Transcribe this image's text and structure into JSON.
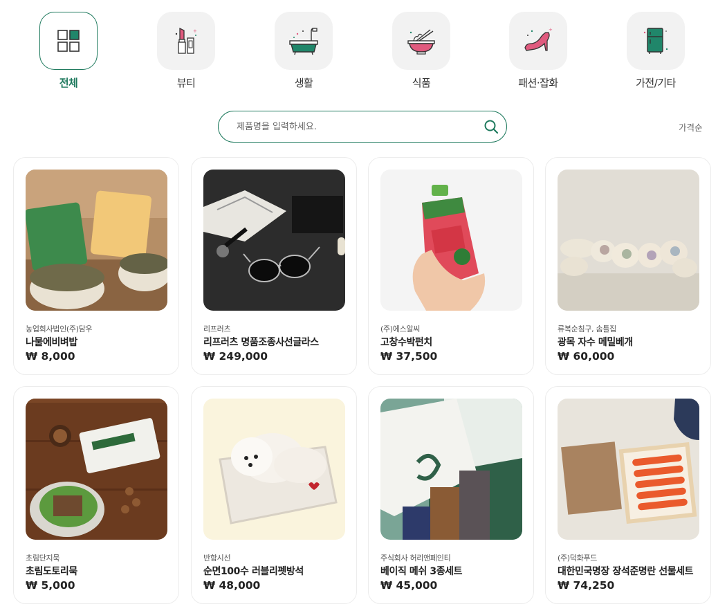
{
  "categories": [
    {
      "label": "전체",
      "icon": "grid-icon",
      "active": true
    },
    {
      "label": "뷰티",
      "icon": "lipstick-icon",
      "active": false
    },
    {
      "label": "생활",
      "icon": "bathtub-icon",
      "active": false
    },
    {
      "label": "식품",
      "icon": "noodle-bowl-icon",
      "active": false
    },
    {
      "label": "패션·잡화",
      "icon": "high-heel-icon",
      "active": false
    },
    {
      "label": "가전/기타",
      "icon": "refrigerator-icon",
      "active": false
    }
  ],
  "search": {
    "placeholder": "제품명을 입력하세요.",
    "value": ""
  },
  "sort": {
    "label": "가격순"
  },
  "products": [
    {
      "seller": "농업회사법인(주)담우",
      "name": "나물에비벼밥",
      "price": "₩ 8,000"
    },
    {
      "seller": "리프러츠",
      "name": "리프러츠 명품조종사선글라스",
      "price": "₩ 249,000"
    },
    {
      "seller": "(주)에스알씨",
      "name": "고창수박펀치",
      "price": "₩ 37,500"
    },
    {
      "seller": "류복순침구, 솜틀집",
      "name": "광목 자수 메밀베개",
      "price": "₩ 60,000"
    },
    {
      "seller": "초림단지묵",
      "name": "초림도토리묵",
      "price": "₩ 5,000"
    },
    {
      "seller": "반함시선",
      "name": "순면100수 러블리펫방석",
      "price": "₩ 48,000"
    },
    {
      "seller": "주식회사 허리앤페인티",
      "name": "베이직 메쉬 3종세트",
      "price": "₩ 45,000"
    },
    {
      "seller": "(주)덕화푸드",
      "name": "대한민국명장 장석준명란 선물세트",
      "price": "₩ 74,250"
    }
  ],
  "colors": {
    "accent": "#1f7a5e",
    "icon_green": "#20866a",
    "icon_pink": "#e05a7e"
  }
}
